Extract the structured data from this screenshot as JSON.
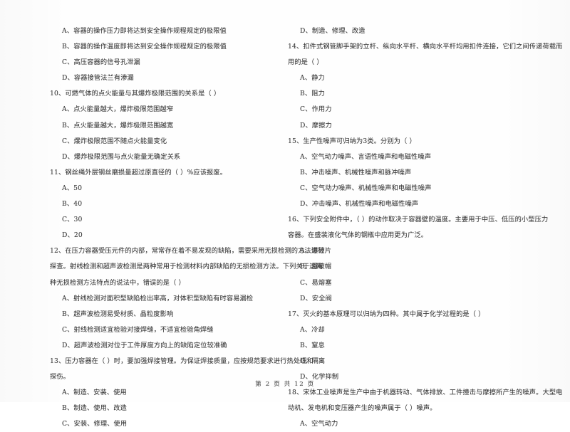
{
  "document": {
    "type": "scanned-exam-page",
    "language": "zh",
    "footer": "第 2 页 共 12 页"
  },
  "left_column": {
    "blocks": [
      {
        "kind": "option",
        "text": "A、容器的操作压力即将达到安全操作规程规定的极限值"
      },
      {
        "kind": "option",
        "text": "B、容器的操作温度即将达到安全操作规程规定的极限值"
      },
      {
        "kind": "option",
        "text": "C、高压容器的信号孔泄漏"
      },
      {
        "kind": "option",
        "text": "D、容器接管法兰有渗漏"
      },
      {
        "kind": "stem",
        "text": "10、可燃气体的点火能量与其爆炸极限范围的关系是（        ）"
      },
      {
        "kind": "option",
        "text": "A、点火能量越大，爆炸极限范围越窄"
      },
      {
        "kind": "option",
        "text": "B、点火能量越大，爆炸极限范围越宽"
      },
      {
        "kind": "option",
        "text": "C、爆炸极限范围不随点火能量变化"
      },
      {
        "kind": "option",
        "text": "D、爆炸极限范围与点火能量无确定关系"
      },
      {
        "kind": "stem",
        "text": "11、钢丝绳外层钢丝磨损量超过原直径的（        ）%应该报废。"
      },
      {
        "kind": "option",
        "text": "A、50"
      },
      {
        "kind": "option",
        "text": "B、40"
      },
      {
        "kind": "option",
        "text": "C、30"
      },
      {
        "kind": "option",
        "text": "D、20"
      },
      {
        "kind": "stem",
        "text": "12、在压力容器受压元件的内部，常常存在着不易发现的缺陷，需要采用无损检测的方法进行"
      },
      {
        "kind": "cont",
        "text": "探查。射线检测和超声波检测是两种常用于检测材料内部缺陷的无损检测方法。下列关于这两"
      },
      {
        "kind": "cont",
        "text": "种无损检测方法特点的说法中，错误的是（        ）"
      },
      {
        "kind": "option",
        "text": "A、射线检测对面积型缺陷检出率高，对体积型缺陷有时容易漏检"
      },
      {
        "kind": "option",
        "text": "B、超声波检测易受材质、晶粒度影响"
      },
      {
        "kind": "option",
        "text": "C、射线检测适宜检验对接焊缝，不适宜检验角焊缝"
      },
      {
        "kind": "option",
        "text": "D、超声波检测对位于工件厚度方向上的缺陷定位较准确"
      },
      {
        "kind": "stem",
        "text": "13、压力容器在（        ）时，要加强焊接管理。为保证焊接质量，应按规范要求进行热处理和"
      },
      {
        "kind": "cont",
        "text": "探伤。"
      },
      {
        "kind": "option",
        "text": "A、制造、安装、使用"
      },
      {
        "kind": "option",
        "text": "B、制造、使用、改造"
      },
      {
        "kind": "option",
        "text": "C、安装、修理、使用"
      }
    ]
  },
  "right_column": {
    "blocks": [
      {
        "kind": "option",
        "text": "D、制造、修理、改造"
      },
      {
        "kind": "stem",
        "text": "14、扣件式钢管脚手架的立杆、纵向水平杆、横向水平杆均用扣件连接，它们之间传递荷载而"
      },
      {
        "kind": "cont",
        "text": "用的是（        ）"
      },
      {
        "kind": "option",
        "text": "A、静力"
      },
      {
        "kind": "option",
        "text": "B、阻力"
      },
      {
        "kind": "option",
        "text": "C、作用力"
      },
      {
        "kind": "option",
        "text": "D、摩擦力"
      },
      {
        "kind": "stem",
        "text": "15、生产性噪声可归纳为3类。分别为（        ）"
      },
      {
        "kind": "option",
        "text": "A、空气动力噪声、言语性噪声和电磁性噪声"
      },
      {
        "kind": "option",
        "text": "B、冲击噪声、机械性噪声和脉冲噪声"
      },
      {
        "kind": "option",
        "text": "C、空气动力噪声、机械性噪声和电磁性噪声"
      },
      {
        "kind": "option",
        "text": "D、冲击噪声、机械性噪声和电磁性噪声"
      },
      {
        "kind": "stem",
        "text": "16、下列安全附件中，（        ）的动作取决于容器壁的温度。主要用于中压、低压的小型压力"
      },
      {
        "kind": "cont",
        "text": "容器。在盛装液化气体的钢瓶中应用更为广泛。"
      },
      {
        "kind": "option",
        "text": "A、爆破片"
      },
      {
        "kind": "option",
        "text": "B、爆破帽"
      },
      {
        "kind": "option",
        "text": "C、易熔塞"
      },
      {
        "kind": "option",
        "text": "D、安全阀"
      },
      {
        "kind": "stem",
        "text": "17、灭火的基本原理可以归纳为四种。其中属于化学过程的是（        ）"
      },
      {
        "kind": "option",
        "text": "A、冷却"
      },
      {
        "kind": "option",
        "text": "B、窒息"
      },
      {
        "kind": "option",
        "text": "C、隔离"
      },
      {
        "kind": "option",
        "text": "D、化学抑制"
      },
      {
        "kind": "stem",
        "text": "18、宋体工业噪声是生产中由于机器转动、气体排放、工件撞击与摩擦所产生的噪声。大型电"
      },
      {
        "kind": "cont",
        "text": "动机、发电机和变压器产生的噪声属于（        ）噪声。"
      },
      {
        "kind": "option",
        "text": "A、空气动力"
      }
    ]
  }
}
